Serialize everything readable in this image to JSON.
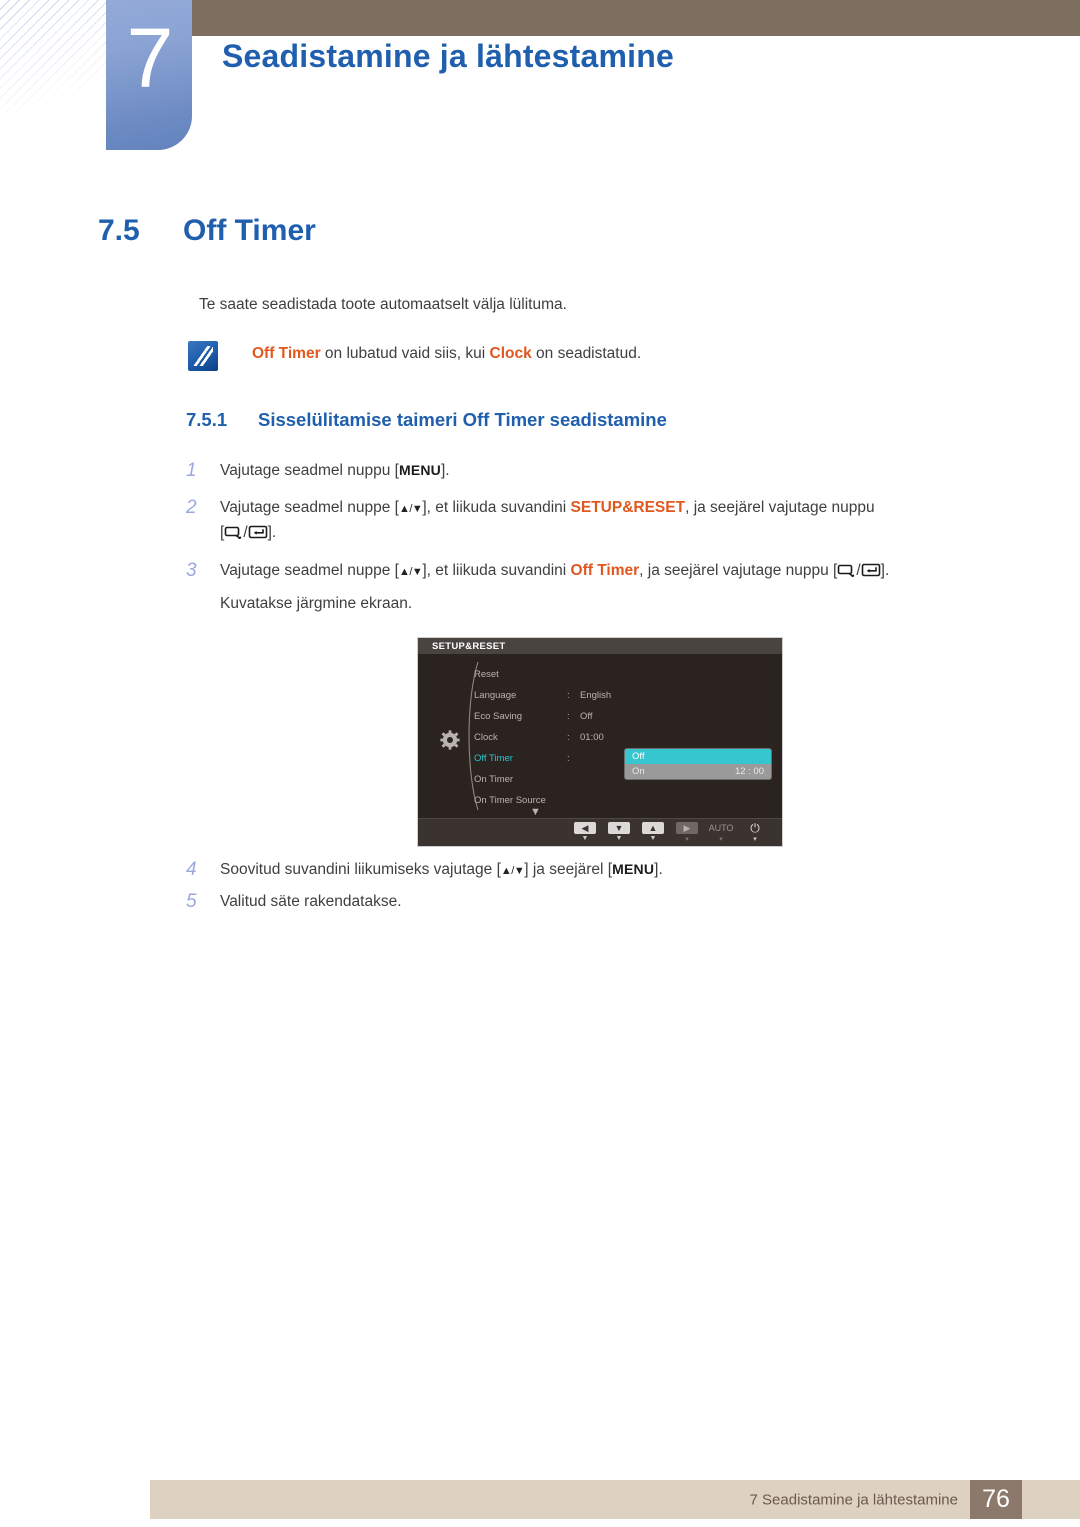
{
  "chapter": {
    "number": "7",
    "title": "Seadistamine ja lähtestamine"
  },
  "section": {
    "number": "7.5",
    "title": "Off Timer"
  },
  "intro": "Te saate seadistada toote automaatselt välja lülituma.",
  "note": {
    "icon": "note-pencil-icon",
    "part1": "Off Timer",
    "part2": " on lubatud vaid siis, kui ",
    "part3": "Clock",
    "part4": " on seadistatud."
  },
  "subsection": {
    "number": "7.5.1",
    "title": "Sisselülitamise taimeri Off Timer seadistamine"
  },
  "steps": [
    {
      "num": "1",
      "a": "Vajutage seadmel nuppu [",
      "kbd": "MENU",
      "b": "]."
    },
    {
      "num": "2",
      "a": "Vajutage seadmel nuppe [",
      "arrows": "▲/▼",
      "b": "], et liikuda suvandini ",
      "hl": "SETUP&RESET",
      "c": ", ja seejärel vajutage nuppu",
      "d": "[",
      "e": "/",
      "f": "]."
    },
    {
      "num": "3",
      "a": "Vajutage seadmel nuppe [",
      "arrows": "▲/▼",
      "b": "], et liikuda suvandini ",
      "hl": "Off Timer",
      "c": ", ja seejärel vajutage nuppu [",
      "d": "/",
      "e": "].",
      "extra": "Kuvatakse järgmine ekraan."
    },
    {
      "num": "4",
      "a": "Soovitud suvandini liikumiseks vajutage [",
      "arrows": "▲/▼",
      "b": "] ja seejärel [",
      "kbd": "MENU",
      "c": "]."
    },
    {
      "num": "5",
      "a": "Valitud säte rakendatakse."
    }
  ],
  "osd": {
    "title": "SETUP&RESET",
    "icon": "gear-icon",
    "rows": [
      {
        "label": "Reset",
        "colon": "",
        "value": "",
        "active": false
      },
      {
        "label": "Language",
        "colon": ":",
        "value": "English",
        "active": false
      },
      {
        "label": "Eco Saving",
        "colon": ":",
        "value": "Off",
        "active": false
      },
      {
        "label": "Clock",
        "colon": ":",
        "value": "01:00",
        "active": false
      },
      {
        "label": "Off Timer",
        "colon": ":",
        "value": "",
        "active": true
      },
      {
        "label": "On Timer",
        "colon": "",
        "value": "",
        "active": false
      },
      {
        "label": "On Timer Source",
        "colon": "",
        "value": "",
        "active": false
      }
    ],
    "scroll_down": "▼",
    "dropdown": {
      "selected_label": "Off",
      "other_label": "On",
      "other_time": "12 : 00",
      "highlight_color": "#36c6cf"
    },
    "footer_buttons": [
      {
        "key": "◀",
        "tick": "▼",
        "dim": false,
        "type": "key"
      },
      {
        "key": "▼",
        "tick": "▼",
        "dim": false,
        "type": "key"
      },
      {
        "key": "▲",
        "tick": "▼",
        "dim": false,
        "type": "key"
      },
      {
        "key": "▶",
        "tick": "▾",
        "dim": true,
        "type": "key"
      },
      {
        "key": "AUTO",
        "tick": "▾",
        "dim": true,
        "type": "text"
      },
      {
        "key": "⏻",
        "tick": "▾",
        "dim": false,
        "type": "power"
      }
    ]
  },
  "footer": {
    "text": "7 Seadistamine ja lähtestamine",
    "page": "76"
  },
  "colors": {
    "header_brown": "#7d6e60",
    "chapter_blue": "#1f5fae",
    "accent_orange": "#e2571e",
    "footer_beige": "#ddd2c1",
    "page_box": "#8d796b",
    "osd_bg": "#2b2320",
    "osd_cyan": "#2fc3cd"
  }
}
